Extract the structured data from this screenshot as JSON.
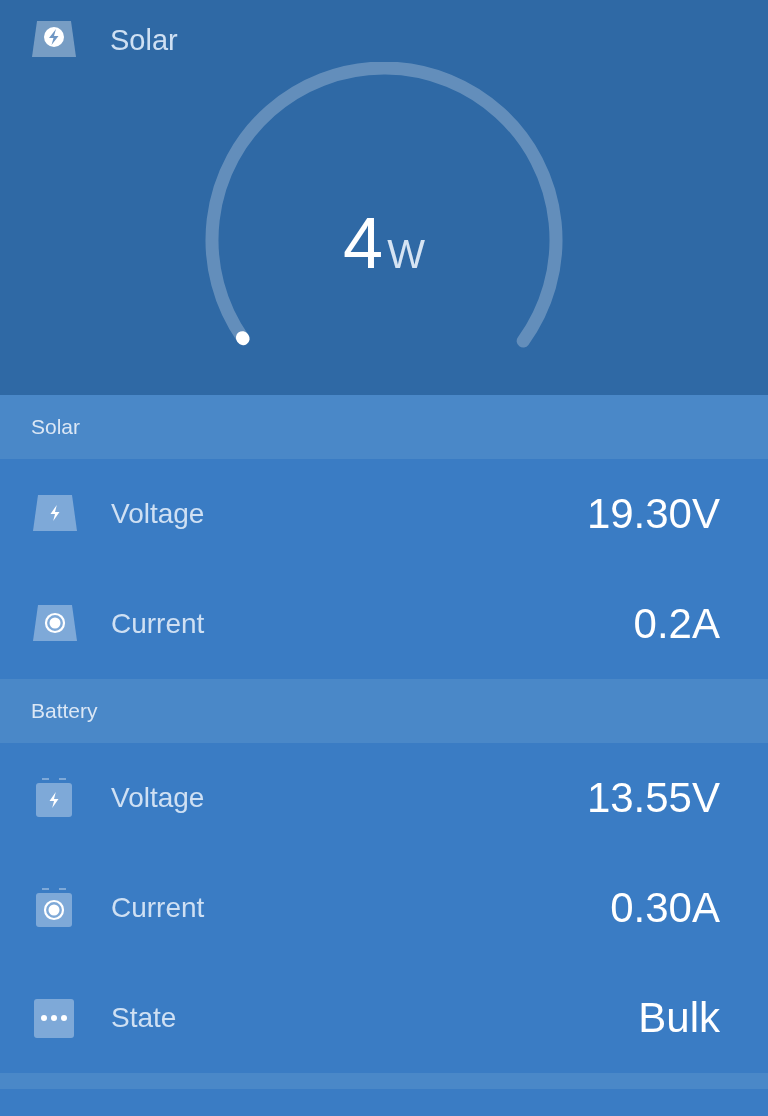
{
  "header": {
    "title": "Solar",
    "gauge": {
      "value": "4",
      "unit": "W"
    }
  },
  "sections": [
    {
      "title": "Solar",
      "rows": [
        {
          "kind": "panel-bolt",
          "label": "Voltage",
          "value": "19.30V"
        },
        {
          "kind": "panel-current",
          "label": "Current",
          "value": "0.2A"
        }
      ]
    },
    {
      "title": "Battery",
      "rows": [
        {
          "kind": "battery-bolt",
          "label": "Voltage",
          "value": "13.55V"
        },
        {
          "kind": "battery-current",
          "label": "Current",
          "value": "0.30A"
        },
        {
          "kind": "dots",
          "label": "State",
          "value": "Bulk"
        }
      ]
    }
  ]
}
